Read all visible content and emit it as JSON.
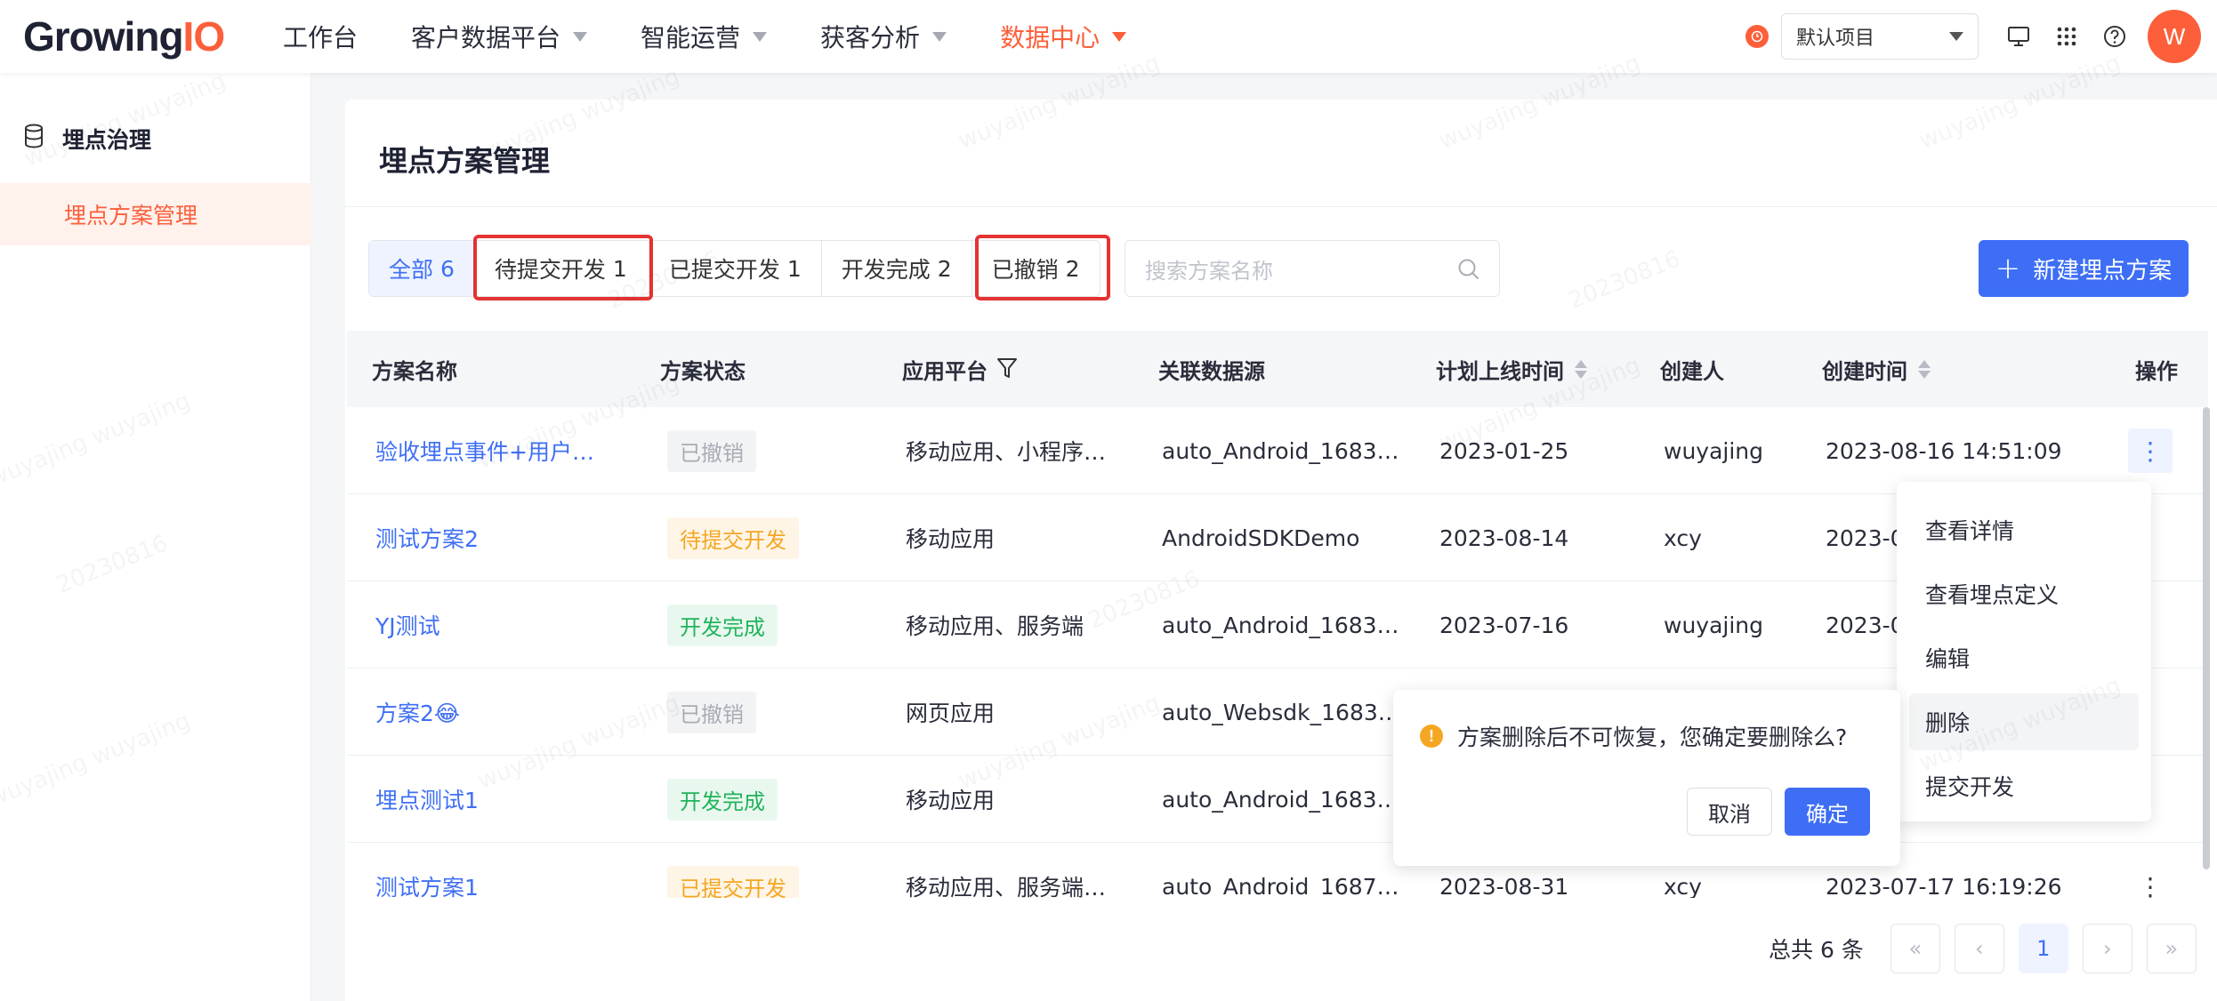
{
  "header": {
    "logo_main": "Growing",
    "logo_io": "IO",
    "nav": [
      {
        "label": "工作台",
        "has_caret": false,
        "active": false
      },
      {
        "label": "客户数据平台",
        "has_caret": true,
        "active": false
      },
      {
        "label": "智能运营",
        "has_caret": true,
        "active": false
      },
      {
        "label": "获客分析",
        "has_caret": true,
        "active": false
      },
      {
        "label": "数据中心",
        "has_caret": true,
        "active": true
      }
    ],
    "project": "默认项目",
    "avatar": "W",
    "accent": "#fc5f3a"
  },
  "sidebar": {
    "group": "埋点治理",
    "item": "埋点方案管理"
  },
  "page": {
    "title": "埋点方案管理",
    "tabs": [
      {
        "label": "全部",
        "count": "6"
      },
      {
        "label": "待提交开发",
        "count": "1"
      },
      {
        "label": "已提交开发",
        "count": "1"
      },
      {
        "label": "开发完成",
        "count": "2"
      },
      {
        "label": "已撤销",
        "count": "2"
      }
    ],
    "search_placeholder": "搜索方案名称",
    "new_button": "新建埋点方案",
    "primary_color": "#3d6ef5"
  },
  "table": {
    "headers": {
      "name": "方案名称",
      "status": "方案状态",
      "platform": "应用平台",
      "datasource": "关联数据源",
      "plan_time": "计划上线时间",
      "creator": "创建人",
      "created": "创建时间",
      "ops": "操作"
    },
    "rows": [
      {
        "name": "验收埋点事件+用户…",
        "status": "已撤销",
        "status_type": "gray",
        "platform": "移动应用、小程序…",
        "datasource": "auto_Android_1683…",
        "plan_time": "2023-01-25",
        "creator": "wuyajing",
        "created": "2023-08-16 14:51:09"
      },
      {
        "name": "测试方案2",
        "status": "待提交开发",
        "status_type": "orange",
        "platform": "移动应用",
        "datasource": "AndroidSDKDemo",
        "plan_time": "2023-08-14",
        "creator": "xcy",
        "created": "2023-0"
      },
      {
        "name": "YJ测试",
        "status": "开发完成",
        "status_type": "green",
        "platform": "移动应用、服务端",
        "datasource": "auto_Android_1683…",
        "plan_time": "2023-07-16",
        "creator": "wuyajing",
        "created": "2023-0"
      },
      {
        "name": "方案2😂",
        "status": "已撤销",
        "status_type": "gray",
        "platform": "网页应用",
        "datasource": "auto_Websdk_1683…",
        "plan_time": "",
        "creator": "",
        "created": ""
      },
      {
        "name": "埋点测试1",
        "status": "开发完成",
        "status_type": "green",
        "platform": "移动应用",
        "datasource": "auto_Android_1683…",
        "plan_time": "",
        "creator": "",
        "created": ""
      },
      {
        "name": "测试方案1",
        "status": "已提交开发",
        "status_type": "orange",
        "platform": "移动应用、服务端…",
        "datasource": "auto_Android_1687…",
        "plan_time": "2023-08-31",
        "creator": "xcy",
        "created": "2023-07-17 16:19:26"
      }
    ]
  },
  "pagination": {
    "total": "总共 6 条",
    "current": "1"
  },
  "menu": {
    "items": [
      "查看详情",
      "查看埋点定义",
      "编辑",
      "删除",
      "提交开发"
    ],
    "hovered": "删除"
  },
  "confirm": {
    "message": "方案删除后不可恢复，您确定要删除么?",
    "cancel": "取消",
    "ok": "确定"
  },
  "watermark": "wuyajing wuyajing",
  "watermark_stamp": "20230816"
}
